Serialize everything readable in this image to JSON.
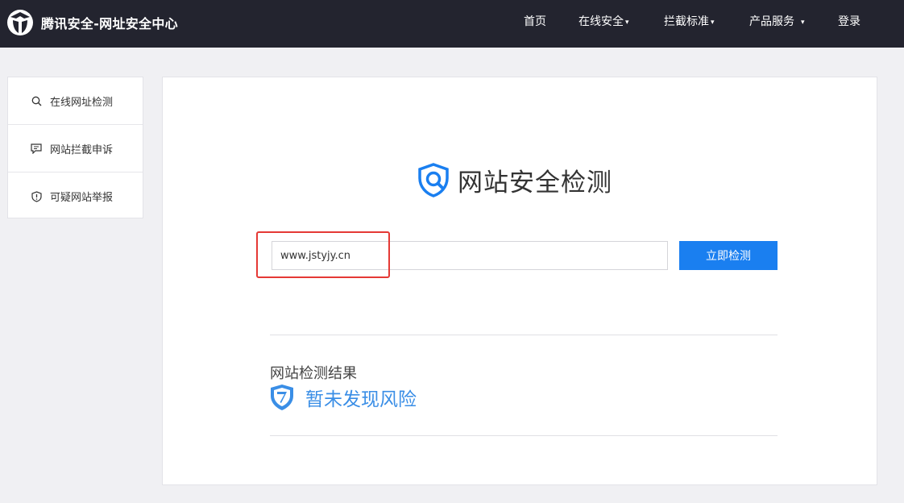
{
  "header": {
    "brand": "腾讯安全-网址安全中心",
    "nav": [
      {
        "label": "首页",
        "has_caret": false
      },
      {
        "label": "在线安全",
        "has_caret": true
      },
      {
        "label": "拦截标准",
        "has_caret": true
      },
      {
        "label": "产品服务",
        "has_caret": true
      },
      {
        "label": "登录",
        "has_caret": false
      }
    ],
    "caret": "▾"
  },
  "sidebar": {
    "items": [
      {
        "label": "在线网址检测",
        "icon": "search-icon"
      },
      {
        "label": "网站拦截申诉",
        "icon": "chat-icon"
      },
      {
        "label": "可疑网站举报",
        "icon": "shield-alert-icon"
      }
    ]
  },
  "main": {
    "title": "网站安全检测",
    "url_value": "www.jstyjy.cn",
    "check_button": "立即检测",
    "result_label": "网站检测结果",
    "result_status": "暂未发现风险"
  },
  "colors": {
    "topbar": "#23242f",
    "accent": "#1a7ff0",
    "result": "#3a8ee6",
    "highlight": "#e53935"
  }
}
